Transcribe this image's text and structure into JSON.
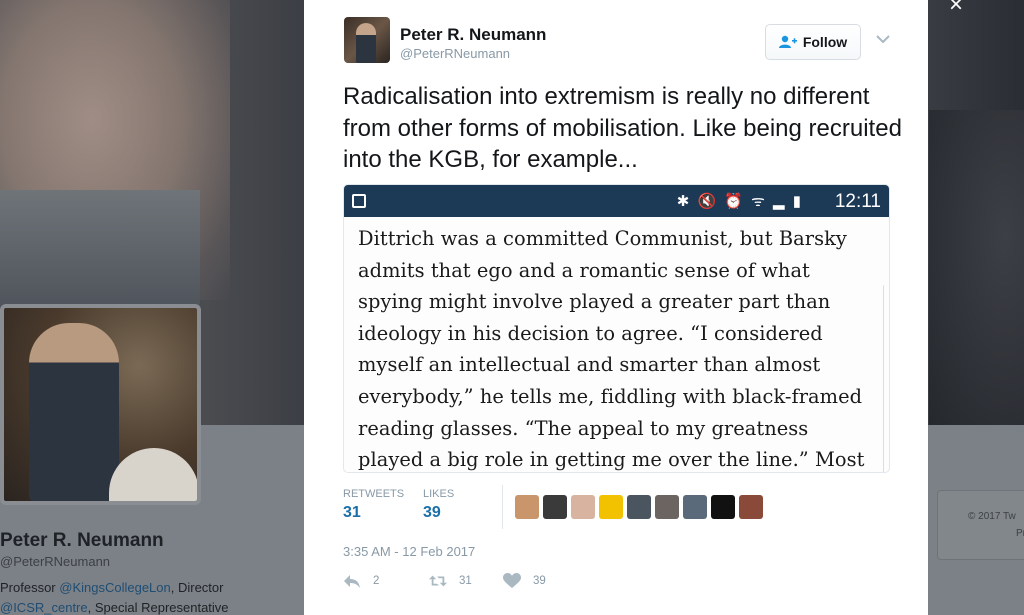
{
  "background": {
    "profile_name": "Peter R. Neumann",
    "profile_handle": "@PeterRNeumann",
    "bio": {
      "prefix": "Professor ",
      "link1": "@KingsCollegeLon",
      "mid": ", Director",
      "link2": "@ICSR_centre",
      "suffix": ", Special Representative"
    },
    "side_card_line1": "© 2017 Tw",
    "side_card_line2": "Pr"
  },
  "close_label": "×",
  "tweet": {
    "author_name": "Peter R. Neumann",
    "author_handle": "@PeterRNeumann",
    "follow_label": "Follow",
    "text": "Radicalisation into extremism is really no different from other forms of mobilisation. Like being recruited into the KGB, for example...",
    "media": {
      "status_time": "12:11",
      "status_icons": "✱ 🔇 ⏰ ᯤ ▂ ▮",
      "article_text": "Dittrich was a committed Communist, but Barsky admits that ego and a romantic sense of what spying might involve played a greater part than ideology in his decision to agree. “I considered myself an intellectual and smarter than almost everybody,” he tells me, fiddling with black-framed reading glasses. “The appeal to my greatness played a big role in getting me over the line.” Most"
    },
    "stats": {
      "retweets_label": "RETWEETS",
      "retweets_value": "31",
      "likes_label": "LIKES",
      "likes_value": "39"
    },
    "likers": [
      {
        "color": "#c9956b"
      },
      {
        "color": "#3a3a3a"
      },
      {
        "color": "#d8b4a0"
      },
      {
        "color": "#f2c200"
      },
      {
        "color": "#4a5560"
      },
      {
        "color": "#6b6460"
      },
      {
        "color": "#5a6a7a"
      },
      {
        "color": "#111111"
      },
      {
        "color": "#8a4a3a"
      }
    ],
    "timestamp": "3:35 AM - 12 Feb 2017",
    "actions": {
      "reply_count": "2",
      "retweet_count": "31",
      "like_count": "39"
    }
  }
}
